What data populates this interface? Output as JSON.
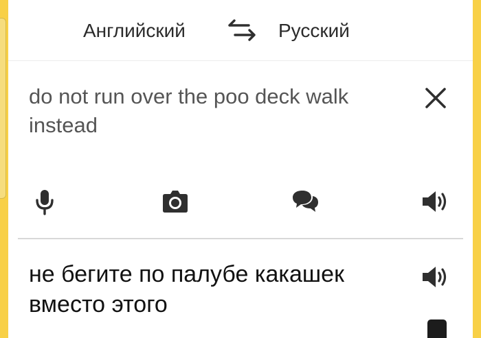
{
  "languages": {
    "source": "Английский",
    "target": "Русский"
  },
  "input": {
    "text": "do not run over the poo deck walk instead"
  },
  "output": {
    "text": "не бегите по палубе какашек вместо этого"
  },
  "icons": {
    "swap": "swap-arrows-icon",
    "clear": "close-icon",
    "microphone": "microphone-icon",
    "camera": "camera-icon",
    "dialog": "chat-bubbles-icon",
    "speaker": "speaker-icon"
  },
  "colors": {
    "background": "#f8d046",
    "card": "#ffffff",
    "source_text": "#555555",
    "result_text": "#111111",
    "icon": "#2f2f2f"
  }
}
